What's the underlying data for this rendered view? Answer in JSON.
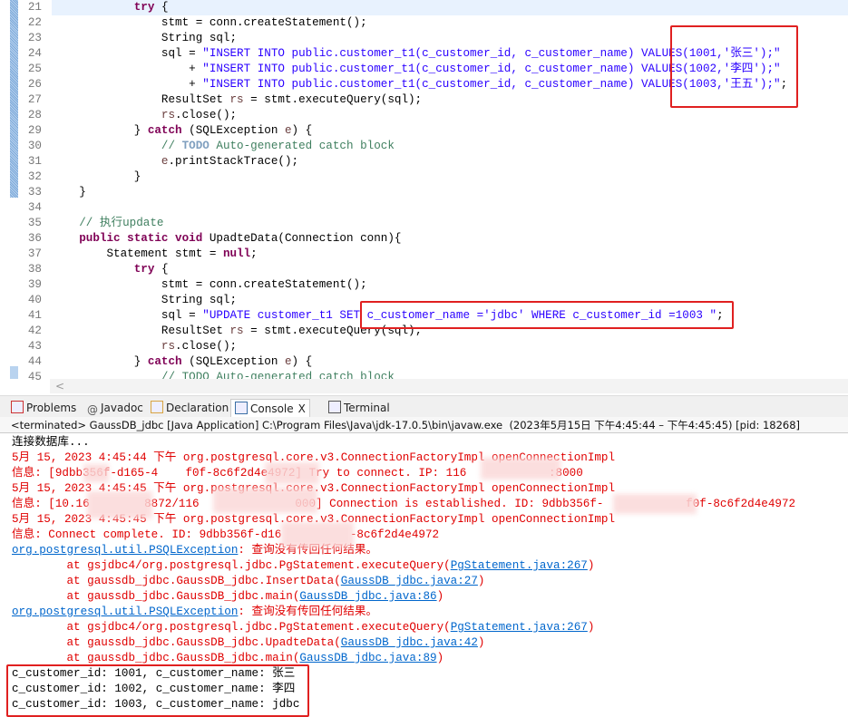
{
  "editor": {
    "lines": [
      {
        "n": "21",
        "cur": true,
        "t": [
          [
            "            ",
            ""
          ],
          [
            "try",
            "kw"
          ],
          [
            " {",
            ""
          ]
        ]
      },
      {
        "n": "22",
        "t": [
          [
            "                stmt = conn.createStatement();",
            ""
          ]
        ]
      },
      {
        "n": "23",
        "t": [
          [
            "                String sql;",
            ""
          ]
        ]
      },
      {
        "n": "24",
        "t": [
          [
            "                sql = ",
            ""
          ],
          [
            "\"INSERT INTO public.customer_t1(c_customer_id, c_customer_name) VALUES(1001,'张三');\"",
            "str"
          ]
        ]
      },
      {
        "n": "25",
        "t": [
          [
            "                    + ",
            ""
          ],
          [
            "\"INSERT INTO public.customer_t1(c_customer_id, c_customer_name) VALUES(1002,'李四');\"",
            "str"
          ]
        ]
      },
      {
        "n": "26",
        "t": [
          [
            "                    + ",
            ""
          ],
          [
            "\"INSERT INTO public.customer_t1(c_customer_id, c_customer_name) VALUES(1003,'王五');\"",
            "str"
          ],
          [
            ";",
            ""
          ]
        ]
      },
      {
        "n": "27",
        "t": [
          [
            "                ResultSet ",
            ""
          ],
          [
            "rs",
            "var"
          ],
          [
            " = stmt.executeQuery(sql);",
            ""
          ]
        ]
      },
      {
        "n": "28",
        "t": [
          [
            "                ",
            ""
          ],
          [
            "rs",
            "var"
          ],
          [
            ".close();",
            ""
          ]
        ]
      },
      {
        "n": "29",
        "t": [
          [
            "            } ",
            ""
          ],
          [
            "catch",
            "kw"
          ],
          [
            " (SQLException ",
            ""
          ],
          [
            "e",
            "var"
          ],
          [
            ") {",
            ""
          ]
        ]
      },
      {
        "n": "30",
        "t": [
          [
            "                // ",
            "cm"
          ],
          [
            "TODO",
            "todo"
          ],
          [
            " Auto-generated catch block",
            "cm"
          ]
        ]
      },
      {
        "n": "31",
        "t": [
          [
            "                ",
            ""
          ],
          [
            "e",
            "var"
          ],
          [
            ".printStackTrace();",
            ""
          ]
        ]
      },
      {
        "n": "32",
        "t": [
          [
            "            }",
            ""
          ]
        ]
      },
      {
        "n": "33",
        "t": [
          [
            "    }",
            ""
          ]
        ]
      },
      {
        "n": "34",
        "t": [
          [
            "",
            ""
          ]
        ]
      },
      {
        "n": "35",
        "t": [
          [
            "    // 执行update",
            "cm"
          ]
        ]
      },
      {
        "n": "36",
        "t": [
          [
            "    ",
            ""
          ],
          [
            "public static void",
            "kw"
          ],
          [
            " UpadteData(Connection conn){",
            ""
          ]
        ]
      },
      {
        "n": "37",
        "t": [
          [
            "        Statement stmt = ",
            ""
          ],
          [
            "null",
            "kw"
          ],
          [
            ";",
            ""
          ]
        ]
      },
      {
        "n": "38",
        "t": [
          [
            "            ",
            ""
          ],
          [
            "try",
            "kw"
          ],
          [
            " {",
            ""
          ]
        ]
      },
      {
        "n": "39",
        "t": [
          [
            "                stmt = conn.createStatement();",
            ""
          ]
        ]
      },
      {
        "n": "40",
        "t": [
          [
            "                String sql;",
            ""
          ]
        ]
      },
      {
        "n": "41",
        "t": [
          [
            "                sql = ",
            ""
          ],
          [
            "\"UPDATE customer_t1 SET c_customer_name ='jdbc' WHERE c_customer_id =1003 \"",
            "str"
          ],
          [
            ";",
            ""
          ]
        ]
      },
      {
        "n": "42",
        "t": [
          [
            "                ResultSet ",
            ""
          ],
          [
            "rs",
            "var"
          ],
          [
            " = stmt.executeQuery(sql);",
            ""
          ]
        ]
      },
      {
        "n": "43",
        "t": [
          [
            "                ",
            ""
          ],
          [
            "rs",
            "var"
          ],
          [
            ".close();",
            ""
          ]
        ]
      },
      {
        "n": "44",
        "t": [
          [
            "            } ",
            ""
          ],
          [
            "catch",
            "kw"
          ],
          [
            " (SQLException ",
            ""
          ],
          [
            "e",
            "var"
          ],
          [
            ") {",
            ""
          ]
        ]
      },
      {
        "n": "45",
        "t": [
          [
            "                // TODO Auto-generated catch block",
            "cm"
          ]
        ]
      }
    ]
  },
  "scroll_left": "<",
  "tabs": [
    {
      "label": "Problems",
      "icon": "problems-icon"
    },
    {
      "label": "Javadoc",
      "icon": "at-icon"
    },
    {
      "label": "Declaration",
      "icon": "declaration-icon"
    },
    {
      "label": "Console",
      "icon": "console-icon",
      "active": true,
      "close": "X"
    },
    {
      "label": "Terminal",
      "icon": "terminal-icon"
    }
  ],
  "status": "<terminated> GaussDB_jdbc [Java Application] C:\\Program Files\\Java\\jdk-17.0.5\\bin\\javaw.exe  (2023年5月15日 下午4:45:44 – 下午4:45:45) [pid: 18268]",
  "console": [
    {
      "t": [
        [
          "连接数据库...",
          "out"
        ]
      ]
    },
    {
      "t": [
        [
          "5月 15, 2023 4:45:44 下午 org.postgresql.core.v3.ConnectionFactoryImpl openConnectionImpl",
          "err"
        ]
      ]
    },
    {
      "t": [
        [
          "信息: [9dbb356f-d165-4    f0f-8c6f2d4e4972] Try to connect. IP: 116            :8000",
          "err"
        ]
      ]
    },
    {
      "t": [
        [
          "5月 15, 2023 4:45:45 下午 org.postgresql.core.v3.ConnectionFactoryImpl openConnectionImpl",
          "err"
        ]
      ]
    },
    {
      "t": [
        [
          "信息: [10.16        8872/116              000] Connection is established. ID: 9dbb356f-            f0f-8c6f2d4e4972",
          "err"
        ]
      ]
    },
    {
      "t": [
        [
          "5月 15, 2023 4:45:45 下午 org.postgresql.core.v3.ConnectionFactoryImpl openConnectionImpl",
          "err"
        ]
      ]
    },
    {
      "t": [
        [
          "信息: Connect complete. ID: 9dbb356f-d16          -8c6f2d4e4972",
          "err"
        ]
      ]
    },
    {
      "t": [
        [
          "org.postgresql.util.PSQLException",
          "link"
        ],
        [
          ": 查询没有传回任何结果。",
          "err"
        ]
      ]
    },
    {
      "t": [
        [
          "        at gsjdbc4/org.postgresql.jdbc.PgStatement.executeQuery(",
          "err"
        ],
        [
          "PgStatement.java:267",
          "link"
        ],
        [
          ")",
          "err"
        ]
      ]
    },
    {
      "t": [
        [
          "        at gaussdb_jdbc.GaussDB_jdbc.InsertData(",
          "err"
        ],
        [
          "GaussDB_jdbc.java:27",
          "link"
        ],
        [
          ")",
          "err"
        ]
      ]
    },
    {
      "t": [
        [
          "        at gaussdb_jdbc.GaussDB_jdbc.main(",
          "err"
        ],
        [
          "GaussDB_jdbc.java:86",
          "link"
        ],
        [
          ")",
          "err"
        ]
      ]
    },
    {
      "t": [
        [
          "org.postgresql.util.PSQLException",
          "link"
        ],
        [
          ": 查询没有传回任何结果。",
          "err"
        ]
      ]
    },
    {
      "t": [
        [
          "        at gsjdbc4/org.postgresql.jdbc.PgStatement.executeQuery(",
          "err"
        ],
        [
          "PgStatement.java:267",
          "link"
        ],
        [
          ")",
          "err"
        ]
      ]
    },
    {
      "t": [
        [
          "        at gaussdb_jdbc.GaussDB_jdbc.UpadteData(",
          "err"
        ],
        [
          "GaussDB_jdbc.java:42",
          "link"
        ],
        [
          ")",
          "err"
        ]
      ]
    },
    {
      "t": [
        [
          "        at gaussdb_jdbc.GaussDB_jdbc.main(",
          "err"
        ],
        [
          "GaussDB_jdbc.java:89",
          "link"
        ],
        [
          ")",
          "err"
        ]
      ]
    },
    {
      "t": [
        [
          "c_customer_id: 1001, c_customer_name: 张三",
          "out"
        ]
      ]
    },
    {
      "t": [
        [
          "c_customer_id: 1002, c_customer_name: 李四",
          "out"
        ]
      ]
    },
    {
      "t": [
        [
          "c_customer_id: 1003, c_customer_name: jdbc",
          "out"
        ]
      ]
    }
  ],
  "colors": {
    "highlight_box": "#e02020",
    "error_text": "#e00000",
    "link": "#0066cc",
    "keyword": "#7f0055",
    "string": "#2a00ff",
    "comment": "#3f7f5f"
  }
}
